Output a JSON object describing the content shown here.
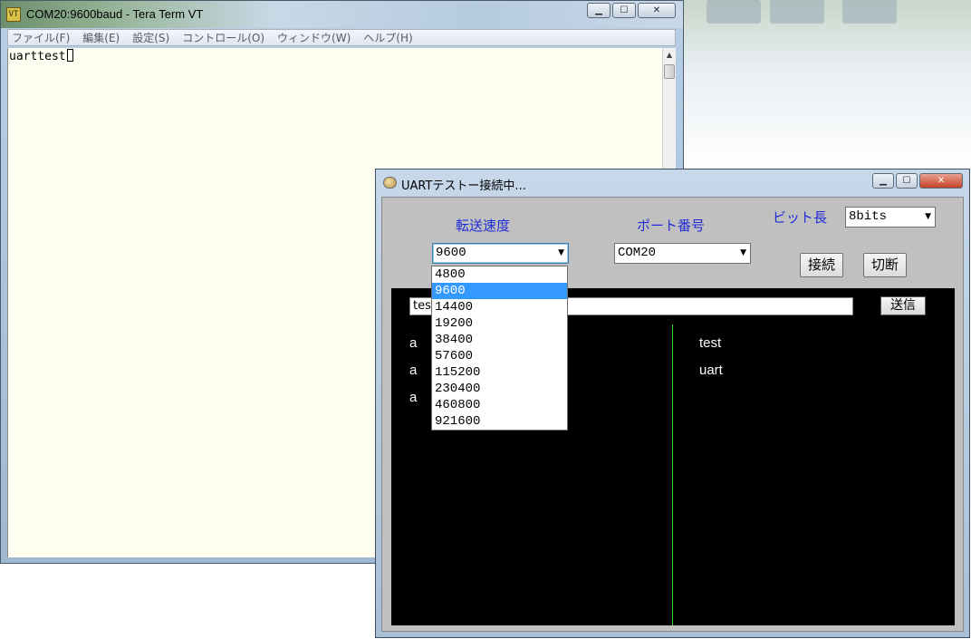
{
  "terminal_window": {
    "title": "COM20:9600baud - Tera Term VT",
    "icon_text": "VT",
    "menu": [
      "ファイル(F)",
      "編集(E)",
      "設定(S)",
      "コントロール(O)",
      "ウィンドウ(W)",
      "ヘルプ(H)"
    ],
    "content": "uarttest"
  },
  "uart_window": {
    "title": "UARTテストー接続中...",
    "labels": {
      "baud": "転送速度",
      "port": "ポート番号",
      "bits": "ビット長"
    },
    "baud_selected": "9600",
    "port_selected": "COM20",
    "bits_selected": "8bits",
    "buttons": {
      "connect": "接続",
      "disconnect": "切断",
      "send": "送信"
    },
    "send_text": "tes",
    "received": [
      "a",
      "a",
      "a"
    ],
    "sent": [
      "test",
      "uart"
    ],
    "baud_options": [
      "4800",
      "9600",
      "14400",
      "19200",
      "38400",
      "57600",
      "115200",
      "230400",
      "460800",
      "921600"
    ],
    "highlighted_option": "9600"
  },
  "colors": {
    "label_blue": "#1f2bd6",
    "terminal_bg": "#fffff1",
    "panel_bg": "#000000",
    "divider_green": "#2fd42f",
    "selection_blue": "#3399ff"
  }
}
